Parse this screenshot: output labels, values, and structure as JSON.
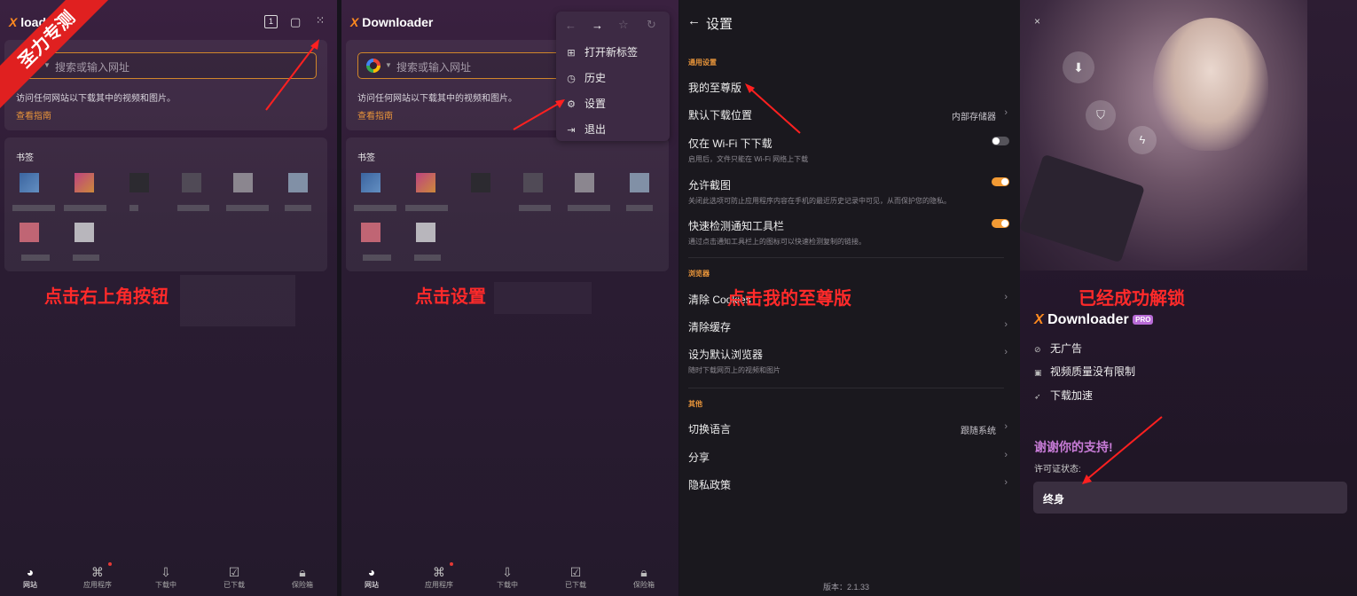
{
  "corner_badge": "圣力专测",
  "app": {
    "name_prefix": "X",
    "name": "Downloader",
    "name_p1_partial": "loader",
    "pro_badge": "PRO"
  },
  "panel1": {
    "tab_count": "1",
    "search_placeholder": "搜索或输入网址",
    "hint": "访问任何网站以下载其中的视频和图片。",
    "guide_link": "查看指南",
    "bookmarks_title": "书签",
    "annotation": "点击右上角按钮"
  },
  "panel2": {
    "search_placeholder": "搜索或输入网址",
    "hint": "访问任何网站以下载其中的视频和图片。",
    "guide_link": "查看指南",
    "bookmarks_title": "书签",
    "menu": {
      "new_tab": "打开新标签",
      "history": "历史",
      "settings": "设置",
      "exit": "退出"
    },
    "annotation": "点击设置"
  },
  "bottom_nav": {
    "site": "网站",
    "apps": "应用程序",
    "downloading": "下载中",
    "downloaded": "已下载",
    "vault": "保险箱"
  },
  "settings": {
    "title": "设置",
    "section_general": "通用设置",
    "premium": "我的至尊版",
    "download_location": "默认下载位置",
    "download_location_value": "内部存储器",
    "wifi_only": "仅在 Wi-Fi 下下载",
    "wifi_only_desc": "启用后，文件只能在 Wi-Fi 网络上下载",
    "allow_screenshot": "允许截图",
    "allow_screenshot_desc": "关闭此选项可防止应用程序内容在手机的最近历史记录中可见，从而保护您的隐私。",
    "quick_detect": "快速检测通知工具栏",
    "quick_detect_desc": "通过点击通知工具栏上的图标可以快速检测复制的链接。",
    "section_browser": "浏览器",
    "clear_cookies": "清除 Cookies",
    "clear_cache": "清除缓存",
    "default_browser": "设为默认浏览器",
    "default_browser_desc": "随时下载网页上的视频和图片",
    "section_other": "其他",
    "language": "切换语言",
    "language_value": "跟随系统",
    "share": "分享",
    "privacy": "隐私政策",
    "version": "版本：2.1.33",
    "annotation": "点击我的至尊版"
  },
  "premium": {
    "annotation": "已经成功解锁",
    "feature_no_ads": "无广告",
    "feature_quality": "视频质量没有限制",
    "feature_speed": "下载加速",
    "thanks": "谢谢你的支持!",
    "license_label": "许可证状态:",
    "license_value": "终身"
  },
  "colors": {
    "accent": "#f29a34",
    "annotation_red": "#ff2a2a",
    "thanks_pink": "#c77bd6"
  }
}
